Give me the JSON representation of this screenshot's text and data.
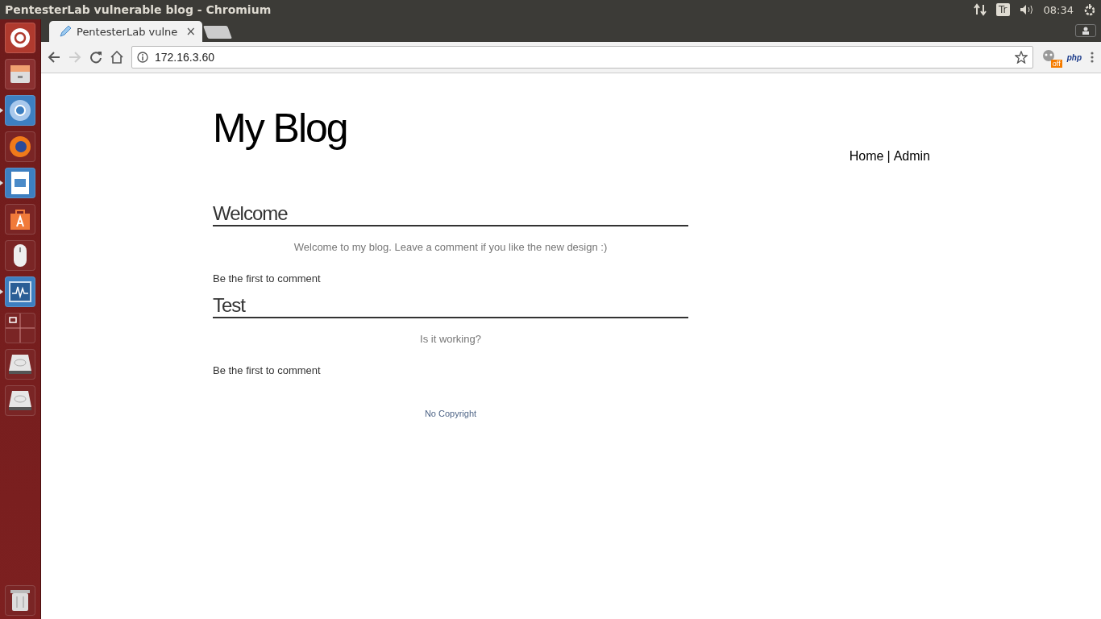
{
  "top_bar": {
    "title": "PentesterLab vulnerable blog - Chromium",
    "keyboard": "Tr",
    "time": "08:34"
  },
  "launcher": [
    {
      "kind": "ubuntu",
      "running": false
    },
    {
      "kind": "files",
      "running": false
    },
    {
      "kind": "chromium",
      "running": true
    },
    {
      "kind": "firefox",
      "running": false
    },
    {
      "kind": "impress",
      "running": true
    },
    {
      "kind": "software",
      "running": false
    },
    {
      "kind": "mouse",
      "running": false
    },
    {
      "kind": "monitor",
      "running": true
    },
    {
      "kind": "workspaces",
      "running": false
    },
    {
      "kind": "drive",
      "running": false
    },
    {
      "kind": "drive",
      "running": false
    },
    {
      "kind": "trash",
      "running": false
    }
  ],
  "tabs": [
    {
      "title": "PentesterLab vulne",
      "close": "×",
      "selected": true
    }
  ],
  "toolbar": {
    "address": "172.16.3.60",
    "extension_badge": "off",
    "php_label": "php"
  },
  "page": {
    "title": "My Blog",
    "nav": [
      {
        "label": "Home",
        "separator": "|"
      },
      {
        "label": "Admin"
      }
    ],
    "posts": [
      {
        "title": "Welcome",
        "body": "Welcome to my blog. Leave a comment if you like the new design :)",
        "comments": "Be the first to comment"
      },
      {
        "title": "Test",
        "body": "Is it working?",
        "comments": "Be the first to comment"
      }
    ],
    "footer": "No Copyright"
  }
}
